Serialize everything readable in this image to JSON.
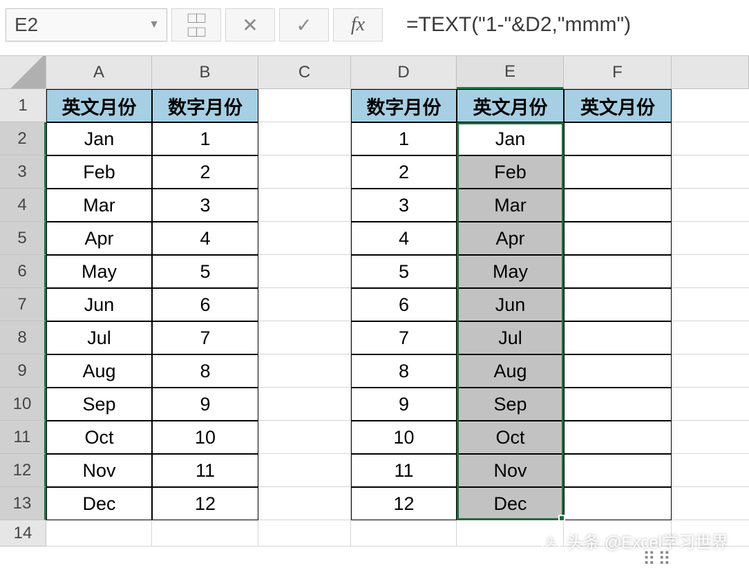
{
  "nameBox": "E2",
  "formula": "=TEXT(\"1-\"&D2,\"mmm\")",
  "fx_label": "fx",
  "colHeaders": [
    "A",
    "B",
    "C",
    "D",
    "E",
    "F"
  ],
  "rowHeaders": [
    "1",
    "2",
    "3",
    "4",
    "5",
    "6",
    "7",
    "8",
    "9",
    "10",
    "11",
    "12",
    "13",
    "14"
  ],
  "headers": {
    "A1": "英文月份",
    "B1": "数字月份",
    "D1": "数字月份",
    "E1": "英文月份",
    "F1": "英文月份"
  },
  "table1": [
    {
      "a": "Jan",
      "b": "1"
    },
    {
      "a": "Feb",
      "b": "2"
    },
    {
      "a": "Mar",
      "b": "3"
    },
    {
      "a": "Apr",
      "b": "4"
    },
    {
      "a": "May",
      "b": "5"
    },
    {
      "a": "Jun",
      "b": "6"
    },
    {
      "a": "Jul",
      "b": "7"
    },
    {
      "a": "Aug",
      "b": "8"
    },
    {
      "a": "Sep",
      "b": "9"
    },
    {
      "a": "Oct",
      "b": "10"
    },
    {
      "a": "Nov",
      "b": "11"
    },
    {
      "a": "Dec",
      "b": "12"
    }
  ],
  "table2": [
    {
      "d": "1",
      "e": "Jan"
    },
    {
      "d": "2",
      "e": "Feb"
    },
    {
      "d": "3",
      "e": "Mar"
    },
    {
      "d": "4",
      "e": "Apr"
    },
    {
      "d": "5",
      "e": "May"
    },
    {
      "d": "6",
      "e": "Jun"
    },
    {
      "d": "7",
      "e": "Jul"
    },
    {
      "d": "8",
      "e": "Aug"
    },
    {
      "d": "9",
      "e": "Sep"
    },
    {
      "d": "10",
      "e": "Oct"
    },
    {
      "d": "11",
      "e": "Nov"
    },
    {
      "d": "12",
      "e": "Dec"
    }
  ],
  "watermark": "头条 @Excel学习世界"
}
